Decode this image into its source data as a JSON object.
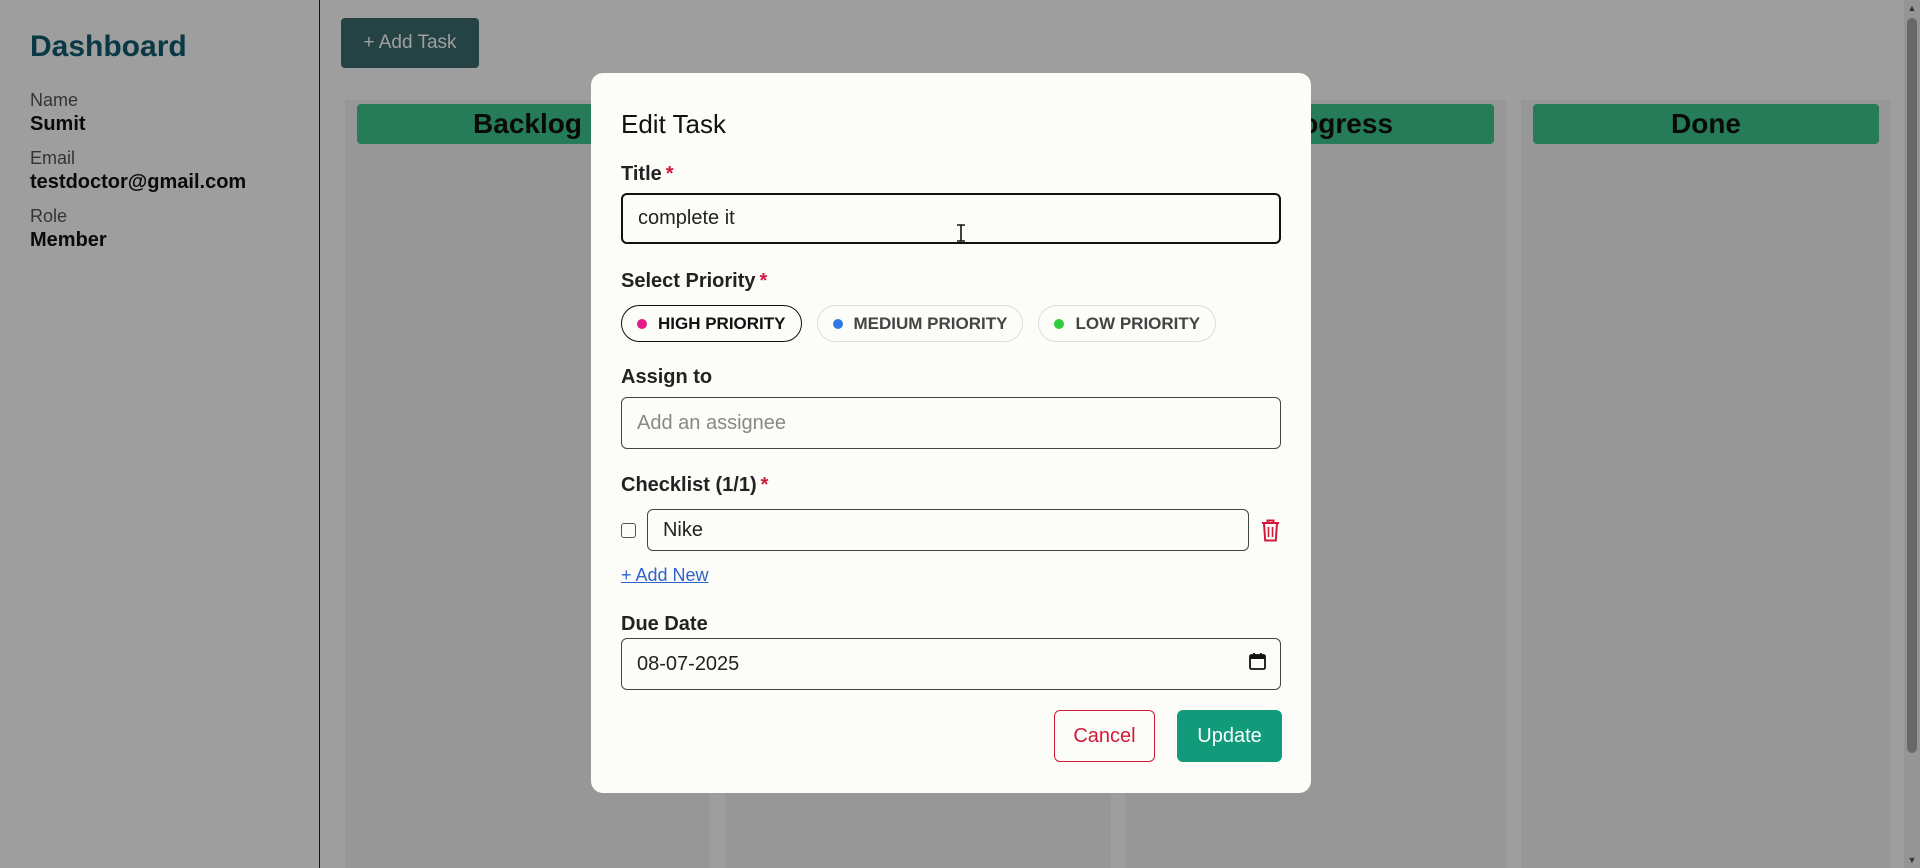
{
  "sidebar": {
    "title": "Dashboard",
    "fields": [
      {
        "label": "Name",
        "value": "Sumit"
      },
      {
        "label": "Email",
        "value": "testdoctor@gmail.com"
      },
      {
        "label": "Role",
        "value": "Member"
      }
    ]
  },
  "board": {
    "add_task_label": "+ Add Task",
    "columns": [
      "Backlog",
      "In Progress",
      "Done"
    ]
  },
  "modal": {
    "title": "Edit Task",
    "title_label": "Title",
    "required_mark": "*",
    "title_value": "complete it",
    "priority_label": "Select Priority",
    "priorities": [
      {
        "label": "HIGH PRIORITY",
        "color": "#e21a8a",
        "selected": true
      },
      {
        "label": "MEDIUM PRIORITY",
        "color": "#2f7ae5",
        "selected": false
      },
      {
        "label": "LOW PRIORITY",
        "color": "#2ecc40",
        "selected": false
      }
    ],
    "assign_label": "Assign to",
    "assign_placeholder": "Add an assignee",
    "checklist_label": "Checklist (1/1)",
    "checklist_items": [
      {
        "text": "Nike",
        "checked": false
      }
    ],
    "add_new_label": "+ Add New",
    "due_date_label": "Due Date",
    "due_date_value": "08-07-2025",
    "cancel_label": "Cancel",
    "update_label": "Update"
  },
  "icons": {
    "delete": "trash-icon",
    "calendar": "calendar-icon",
    "cursor": "text-cursor-icon"
  },
  "colors": {
    "accent": "#129b7a",
    "danger": "#d11a3a",
    "column_header": "#3ec990",
    "brand": "#0f5d6e"
  }
}
